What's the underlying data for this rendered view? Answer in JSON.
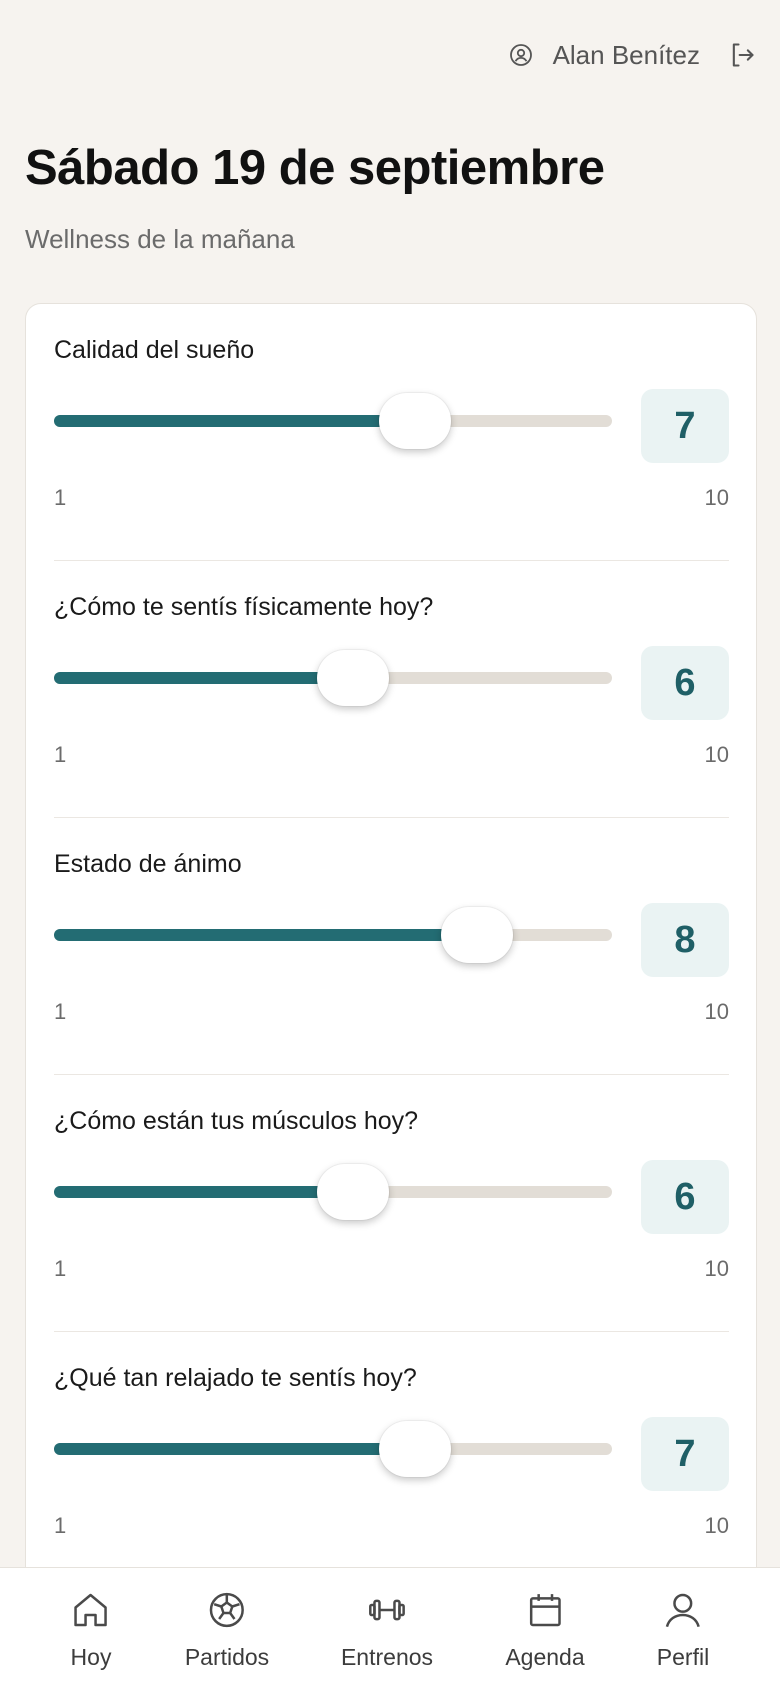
{
  "header": {
    "user_name": "Alan Benítez"
  },
  "page": {
    "title": "Sábado 19 de septiembre",
    "subtitle": "Wellness de la mañana"
  },
  "colors": {
    "accent": "#236c73",
    "track": "#e2ddd6",
    "value_bg": "#eaf3f3",
    "background": "#f6f3ef"
  },
  "questions": [
    {
      "label": "Calidad del sueño",
      "value": "7",
      "min": "1",
      "max": "10"
    },
    {
      "label": "¿Cómo te sentís físicamente hoy?",
      "value": "6",
      "min": "1",
      "max": "10"
    },
    {
      "label": "Estado de ánimo",
      "value": "8",
      "min": "1",
      "max": "10"
    },
    {
      "label": "¿Cómo están tus músculos hoy?",
      "value": "6",
      "min": "1",
      "max": "10"
    },
    {
      "label": "¿Qué tan relajado te sentís hoy?",
      "value": "7",
      "min": "1",
      "max": "10"
    }
  ],
  "nav": [
    {
      "label": "Hoy",
      "icon": "home-icon"
    },
    {
      "label": "Partidos",
      "icon": "soccer-ball-icon"
    },
    {
      "label": "Entrenos",
      "icon": "dumbbell-icon"
    },
    {
      "label": "Agenda",
      "icon": "calendar-icon"
    },
    {
      "label": "Perfil",
      "icon": "user-icon"
    }
  ]
}
